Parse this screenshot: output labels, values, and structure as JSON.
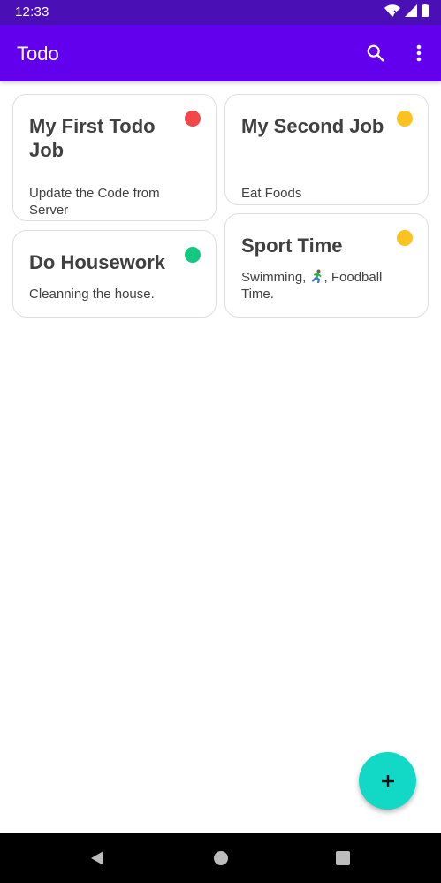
{
  "status_bar": {
    "time": "12:33",
    "icons": [
      "wifi-icon",
      "signal-icon",
      "battery-icon"
    ]
  },
  "app_bar": {
    "title": "Todo",
    "actions": [
      "search-icon",
      "more-vert-icon"
    ]
  },
  "todos": [
    {
      "title": "My First Todo Job",
      "description": "Update the Code from Server",
      "status_color": "#f44747"
    },
    {
      "title": "My Second Job",
      "description": "Eat Foods",
      "status_color": "#fbc320"
    },
    {
      "title": "Do Housework",
      "description": "Cleanning the house.",
      "status_color": "#13c97f"
    },
    {
      "title": "Sport Time",
      "description_before_emoji": "Swimming, ",
      "description_emoji": "runner-emoji",
      "description_after_emoji": ", Foodball Time.",
      "status_color": "#fbc320"
    }
  ],
  "fab": {
    "icon": "plus-icon",
    "color": "#12d9c6"
  },
  "colors": {
    "status_bar": "#4a10b5",
    "app_bar": "#6200ee",
    "nav_bar": "#000000"
  },
  "nav_bar": {
    "icons": [
      "back-icon",
      "home-icon",
      "recents-icon"
    ]
  }
}
